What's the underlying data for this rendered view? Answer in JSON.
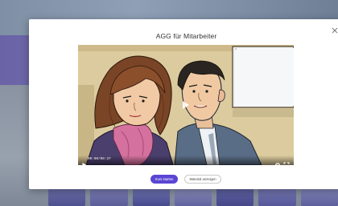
{
  "modal": {
    "title": "AGG für Mitarbeiter",
    "close_icon": "close-icon"
  },
  "video": {
    "time": "00:00/00:37",
    "icons": {
      "play": "play-icon",
      "center_play": "play-overlay-icon",
      "settings": "gear-icon",
      "fullscreen": "fullscreen-icon"
    }
  },
  "actions": {
    "primary_label": "Kurs starten",
    "secondary_label": "Material anzeigen"
  },
  "colors": {
    "accent": "#5a46d4",
    "modal_bg": "#ffffff",
    "banner": "#6a63a6"
  }
}
